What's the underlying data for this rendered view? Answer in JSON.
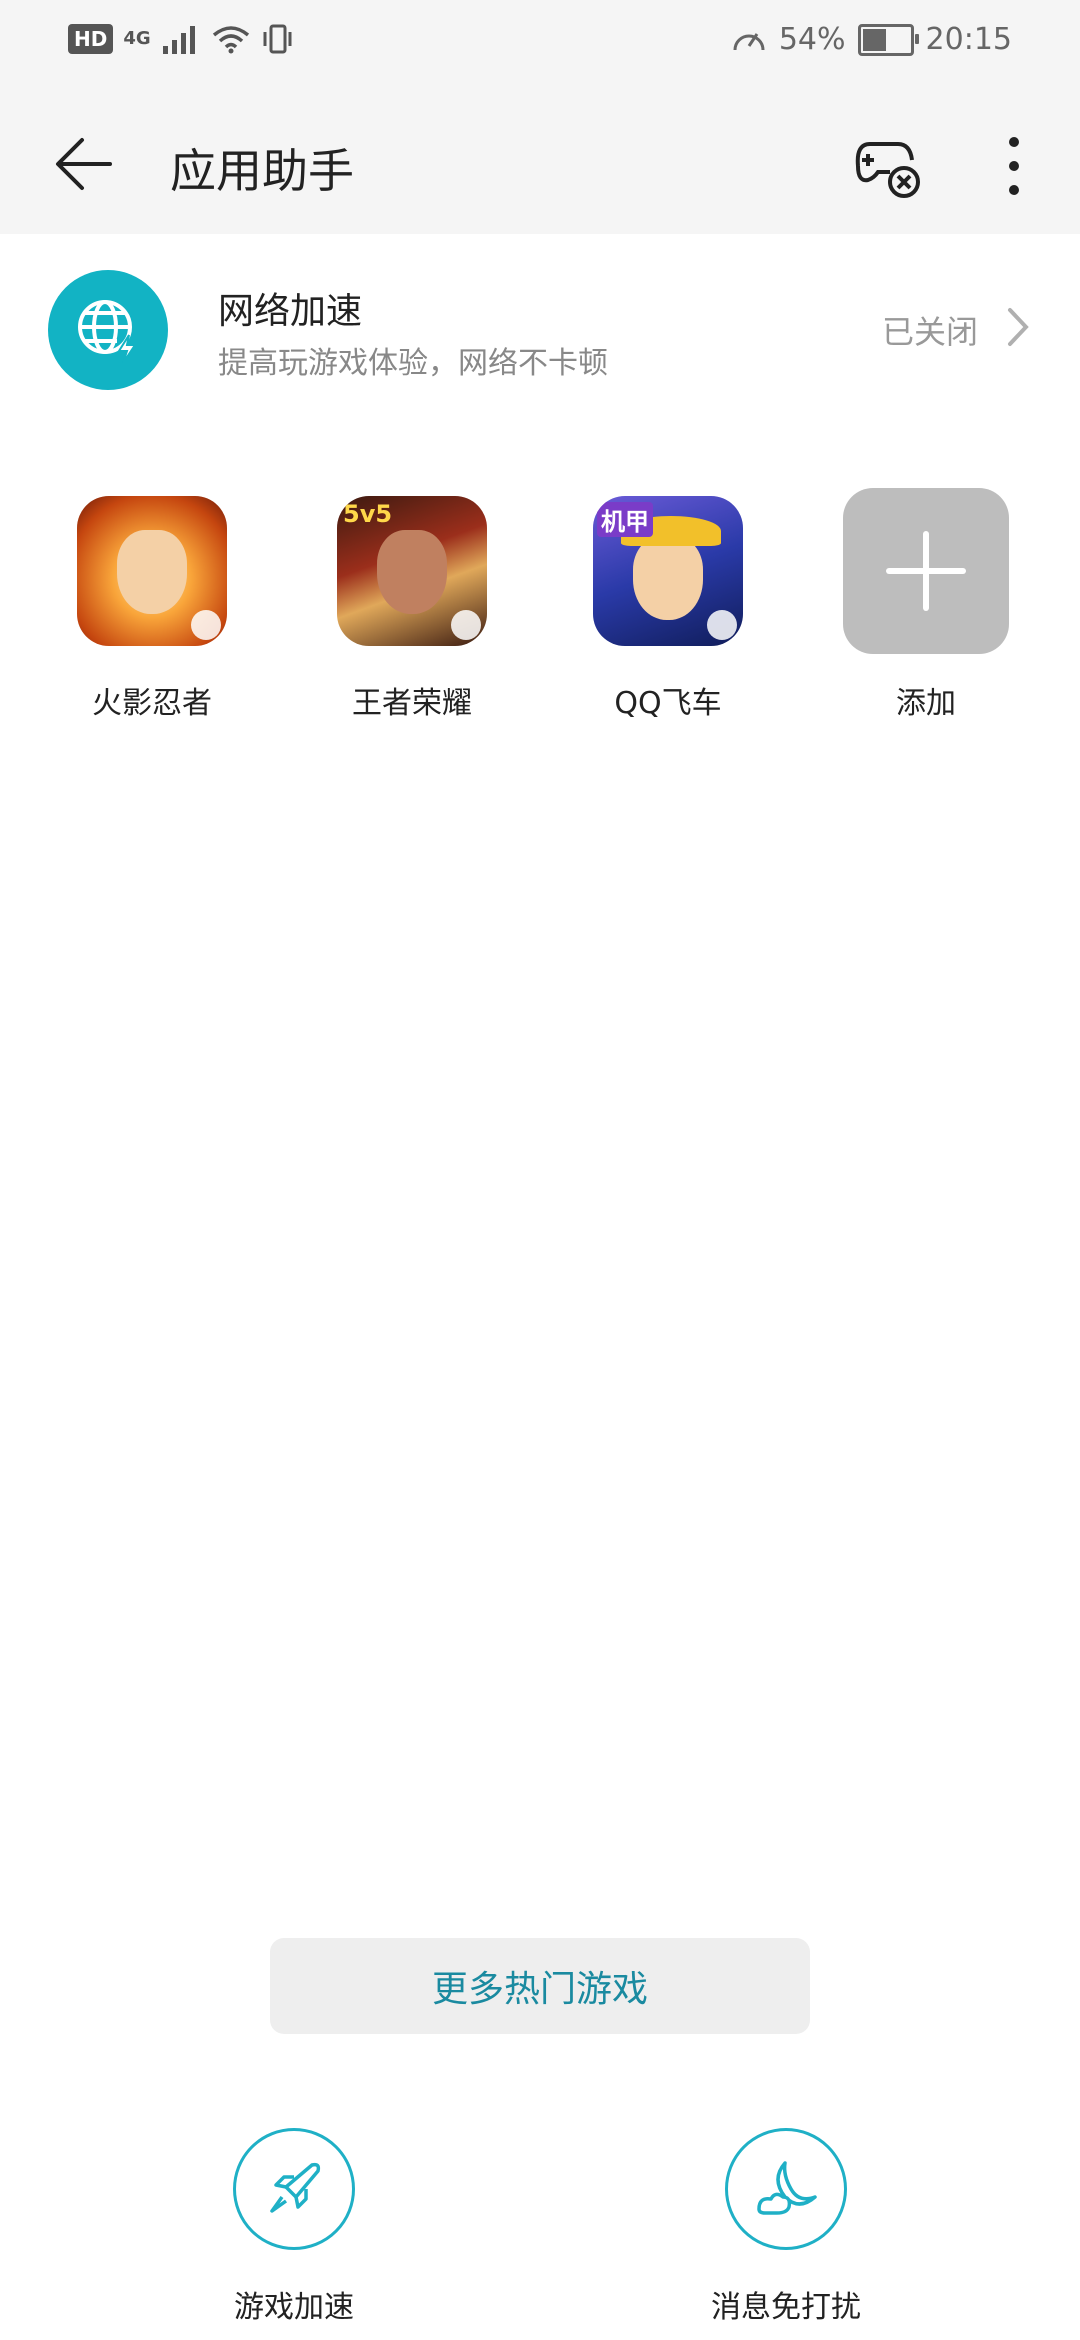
{
  "status_bar": {
    "hd_badge": "HD",
    "network": "4G",
    "speed_icon": "speedometer-icon",
    "battery_percent": "54%",
    "battery_level": 0.54,
    "time": "20:15"
  },
  "header": {
    "title": "应用助手",
    "back_icon": "back-arrow-icon",
    "game_icon": "gamepad-close-icon",
    "more_icon": "more-vertical-icon"
  },
  "network_boost": {
    "title": "网络加速",
    "subtitle": "提高玩游戏体验，网络不卡顿",
    "status": "已关闭",
    "icon": "globe-bolt-icon"
  },
  "games": [
    {
      "label": "火影忍者",
      "icon": "naruto-app-icon"
    },
    {
      "label": "王者荣耀",
      "icon": "honor-of-kings-app-icon"
    },
    {
      "label": "QQ飞车",
      "icon": "qq-speed-app-icon"
    },
    {
      "label": "添加",
      "icon": "add-icon"
    }
  ],
  "game_badges": {
    "hok": "5v5",
    "qq": "机甲"
  },
  "more_games_button": "更多热门游戏",
  "shortcuts": [
    {
      "label": "游戏加速",
      "icon": "rocket-icon"
    },
    {
      "label": "消息免打扰",
      "icon": "moon-icon"
    }
  ],
  "colors": {
    "accent": "#12b3c4",
    "link": "#1a8aa0",
    "header_bg": "#f5f5f5"
  }
}
